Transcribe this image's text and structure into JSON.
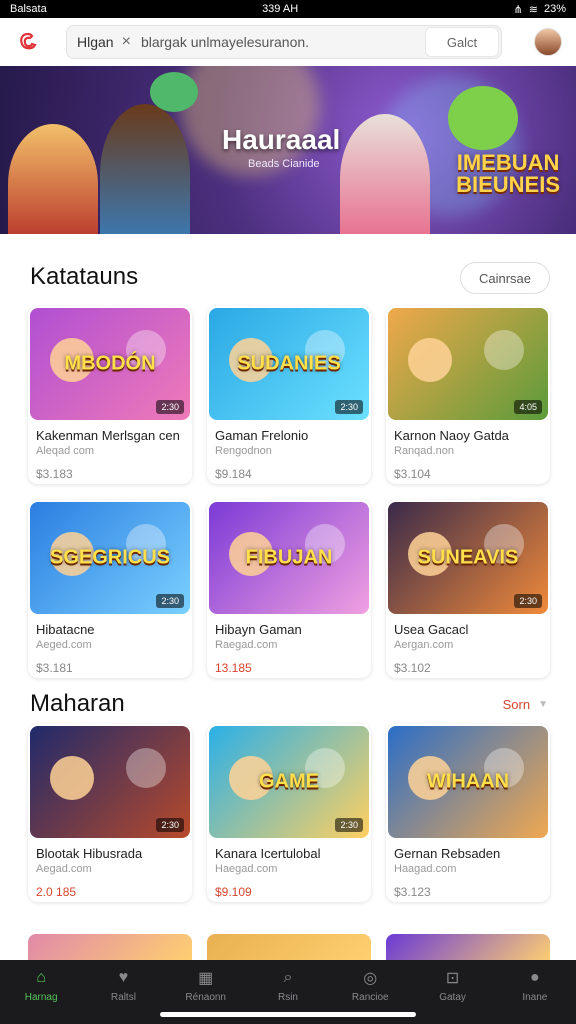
{
  "status": {
    "carrier": "Balsata",
    "time": "339 AH",
    "battery": "23%"
  },
  "header": {
    "search_tag": "Hlgan",
    "search_query": "blargak unlmayelesuranon.",
    "search_button": "Galct"
  },
  "hero": {
    "title": "Hauraaal",
    "subtitle": "Beads Cianide",
    "badge_line1": "IMEBUAN",
    "badge_line2": "BIEUNEIS"
  },
  "sections": {
    "first": {
      "title": "Katatauns",
      "button": "Cainrsae"
    },
    "second": {
      "title": "Maharan",
      "sort": "Sorn"
    }
  },
  "row1": [
    {
      "thumb_text": "MBODÓN",
      "duration": "2:30",
      "name": "Kakenman Merlsgan cen",
      "meta": "Aleqad com",
      "price": "$3.183",
      "hot": false,
      "colors": [
        "#b04fd2",
        "#f07ab8"
      ]
    },
    {
      "thumb_text": "SUDANIES",
      "duration": "2:30",
      "name": "Gaman Frelonio",
      "meta": "Rengodnon",
      "price": "$9.184",
      "hot": false,
      "colors": [
        "#2aa8e4",
        "#6be0ff"
      ]
    },
    {
      "thumb_text": "",
      "duration": "4:05",
      "name": "Karnon Naoy Gatda",
      "meta": "Ranqad.non",
      "price": "$3.104",
      "hot": false,
      "colors": [
        "#f0a84b",
        "#5a9b3a"
      ]
    }
  ],
  "row2": [
    {
      "thumb_text": "SGEGRICUS",
      "duration": "2:30",
      "name": "Hibatacne",
      "meta": "Aeged.com",
      "price": "$3.181",
      "hot": false,
      "colors": [
        "#2b7ee0",
        "#7ad0ff"
      ]
    },
    {
      "thumb_text": "FIBUJAN",
      "duration": "",
      "name": "Hibayn Gaman",
      "meta": "Raegad.com",
      "price": "13.185",
      "hot": true,
      "colors": [
        "#7b3ad6",
        "#f0a0e0"
      ]
    },
    {
      "thumb_text": "SUNEAVIS",
      "duration": "2:30",
      "name": "Usea Gacacl",
      "meta": "Aergan.com",
      "price": "$3.102",
      "hot": false,
      "colors": [
        "#3a2a4a",
        "#f08a3a"
      ]
    }
  ],
  "row3": [
    {
      "thumb_text": "",
      "duration": "2:30",
      "name": "Blootak Hibusrada",
      "meta": "Aegad.com",
      "price": "2.0 185",
      "hot": true,
      "colors": [
        "#1f2a6b",
        "#b84a2a"
      ]
    },
    {
      "thumb_text": "GAME",
      "duration": "2:30",
      "name": "Kanara Icertulobal",
      "meta": "Haegad.com",
      "price": "$9.109",
      "hot": true,
      "colors": [
        "#2ab0e8",
        "#ffd060"
      ]
    },
    {
      "thumb_text": "WIHAAN",
      "duration": "",
      "name": "Gernan Rebsaden",
      "meta": "Haagad.com",
      "price": "$3.123",
      "hot": false,
      "colors": [
        "#2b6ec8",
        "#f0a850"
      ]
    }
  ],
  "partial_colors": [
    "#e08aa8",
    "#e8b050",
    "#6a3ad6"
  ],
  "nav": [
    {
      "label": "Harnag",
      "icon": "home-icon",
      "glyph": "⌂"
    },
    {
      "label": "Raltsl",
      "icon": "heart-badge-icon",
      "glyph": "♥"
    },
    {
      "label": "Rénaonn",
      "icon": "keyboard-icon",
      "glyph": "▦"
    },
    {
      "label": "Rsin",
      "icon": "search-icon",
      "glyph": "⌕"
    },
    {
      "label": "Rancioe",
      "icon": "dribbble-icon",
      "glyph": "◎"
    },
    {
      "label": "Gatay",
      "icon": "tray-icon",
      "glyph": "⊡"
    },
    {
      "label": "Inane",
      "icon": "profile-icon",
      "glyph": "●"
    }
  ],
  "active_nav": 0
}
